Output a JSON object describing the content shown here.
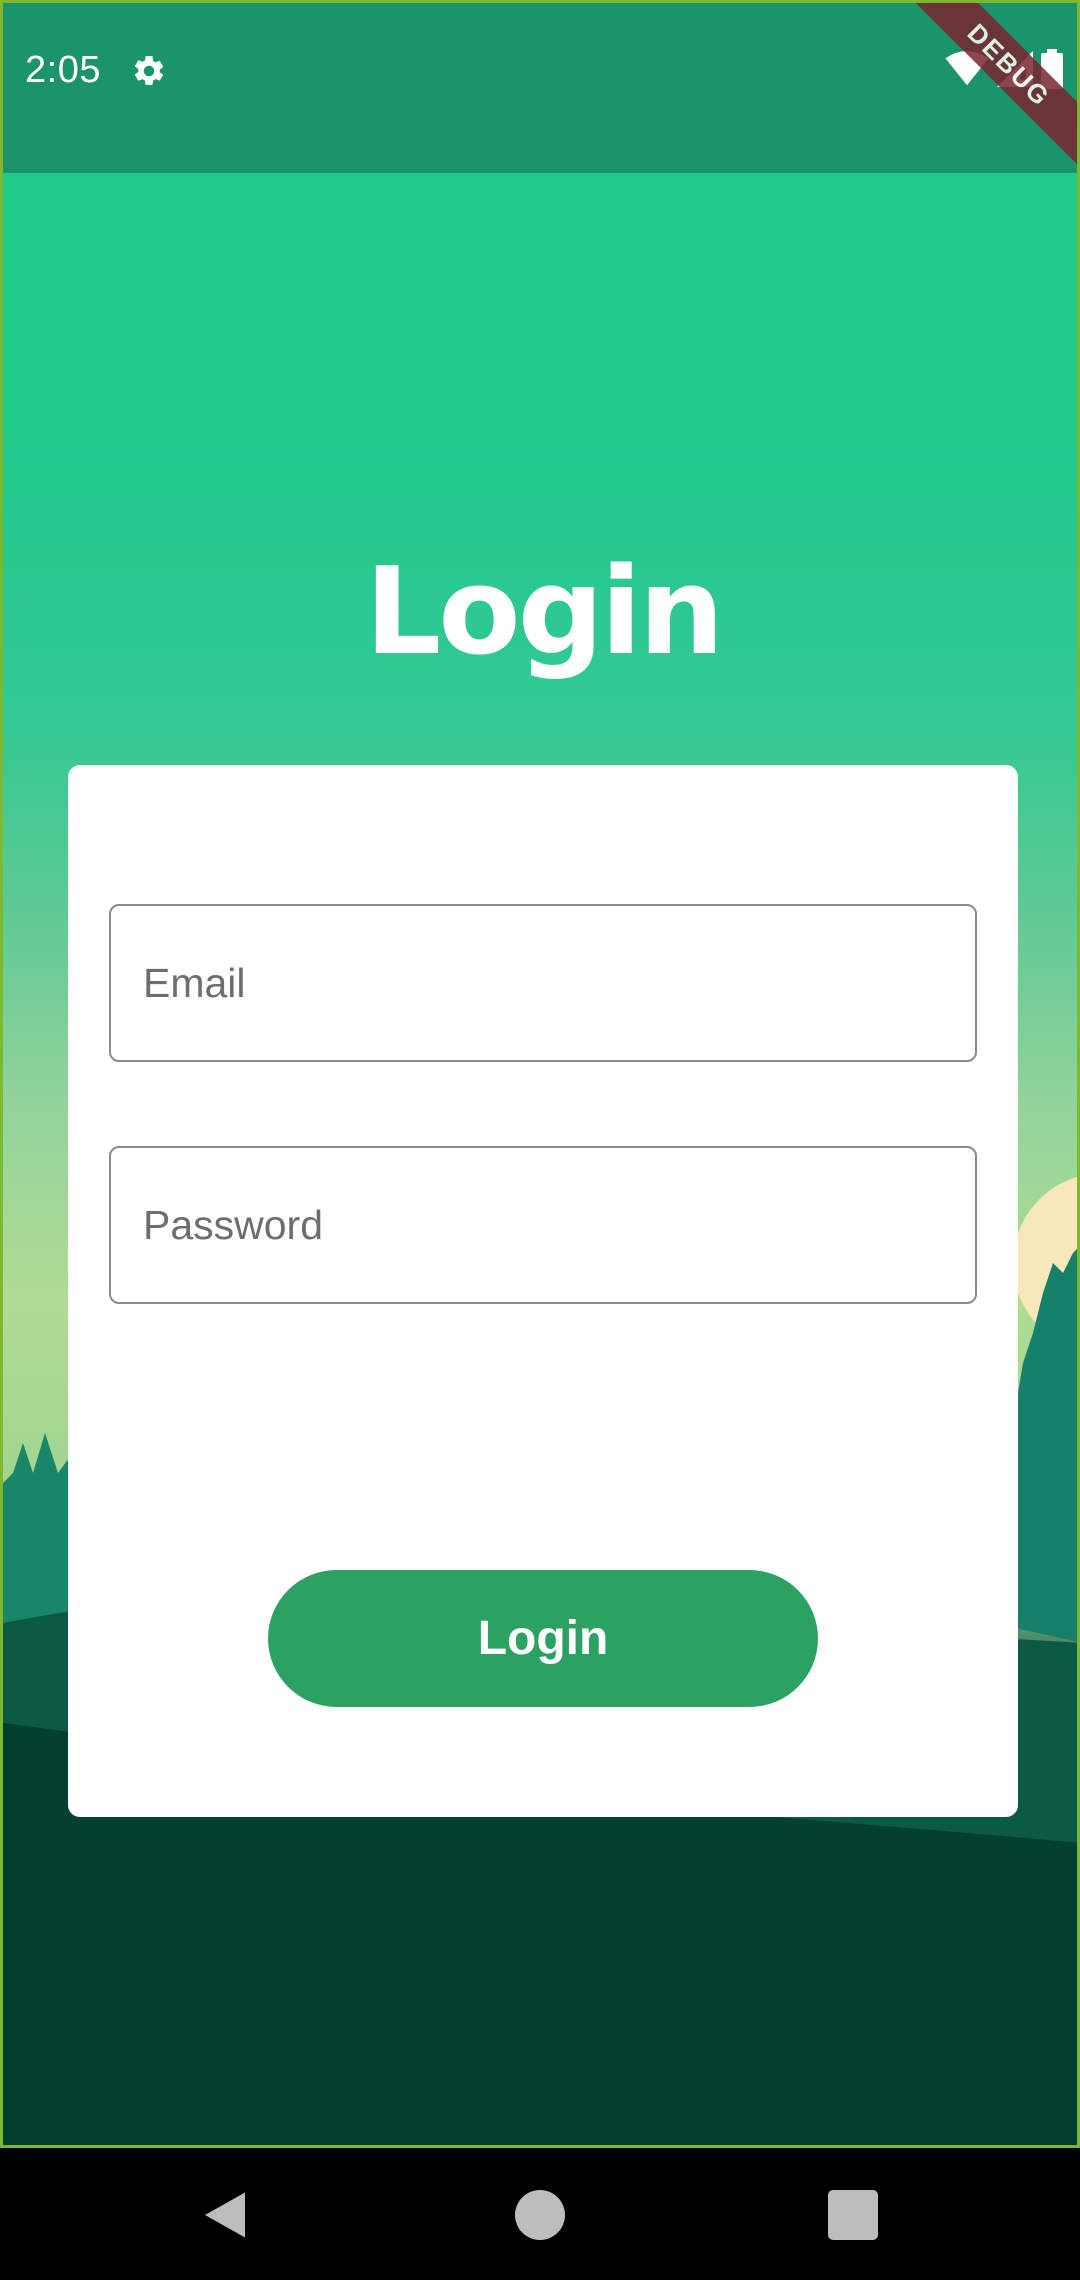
{
  "status_bar": {
    "time": "2:05",
    "icons": [
      "gear-icon",
      "wifi-icon",
      "signal-icon",
      "battery-icon"
    ]
  },
  "debug_banner": "DEBUG",
  "page": {
    "title": "Login"
  },
  "form": {
    "email_placeholder": "Email",
    "password_placeholder": "Password",
    "submit_label": "Login"
  },
  "nav_bar": {
    "icons": [
      "back-icon",
      "home-icon",
      "recents-icon"
    ]
  },
  "colors": {
    "status_bar": "#1b946c",
    "background_top": "#21c98b",
    "button": "#2ca262",
    "card": "#ffffff"
  }
}
